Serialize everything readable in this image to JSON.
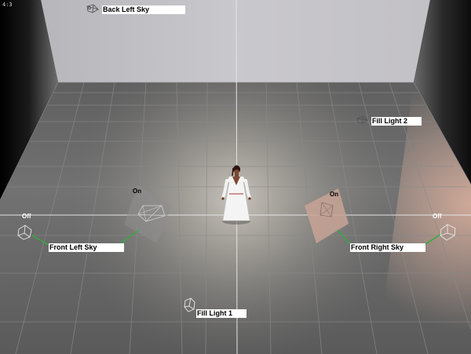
{
  "viewport": {
    "aspect_ratio_label": "4:3"
  },
  "lights": {
    "back_left_sky": {
      "label": "Back Left Sky"
    },
    "fill_light_2": {
      "label": "Fill Light 2"
    },
    "front_left_sky": {
      "label": "Front Left Sky",
      "state_near": "On",
      "state_far": "Off"
    },
    "front_right_sky": {
      "label": "Front Right Sky",
      "state_near": "On",
      "state_far": "Off"
    },
    "fill_light_1": {
      "label": "Fill Light 1"
    }
  },
  "colors": {
    "back_wall": "#c4c4c4",
    "floor": "#6e6e6e",
    "grid": "#8a8a8a",
    "light_link": "#2fae3c",
    "label_bg": "#ffffff"
  }
}
